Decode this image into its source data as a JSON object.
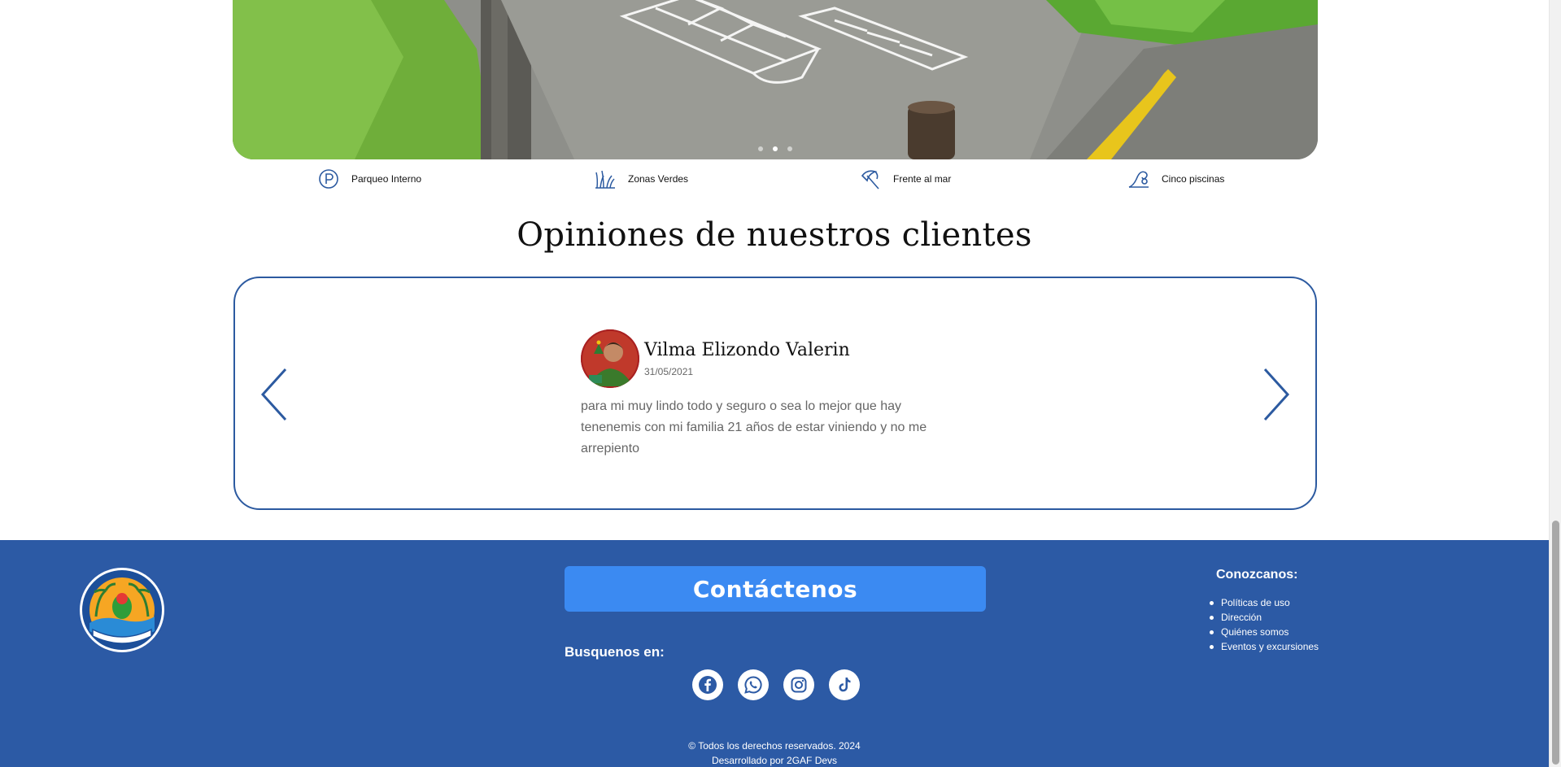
{
  "hero": {
    "slide_dots": 3,
    "active_dot": 1
  },
  "amenities": [
    {
      "icon": "parking-icon",
      "label": "Parqueo Interno"
    },
    {
      "icon": "grass-icon",
      "label": "Zonas Verdes"
    },
    {
      "icon": "beach-umbrella-icon",
      "label": "Frente al mar"
    },
    {
      "icon": "wave-icon",
      "label": "Cinco piscinas"
    }
  ],
  "reviews": {
    "title": "Opiniones de nuestros clientes",
    "current": {
      "name": "Vilma Elizondo Valerin",
      "date": "31/05/2021",
      "text": "para mi muy lindo todo y seguro o sea lo mejor que hay tenenemis con mi familia 21 años de estar viniendo y no me arrepiento"
    },
    "prev_icon": "chevron-left-icon",
    "next_icon": "chevron-right-icon"
  },
  "footer": {
    "contact_label": "Contáctenos",
    "search_label": "Busquenos en:",
    "socials": [
      "facebook-icon",
      "whatsapp-icon",
      "instagram-icon",
      "tiktok-icon"
    ],
    "links_title": "Conozcanos:",
    "links": [
      "Políticas de uso",
      "Dirección",
      "Quiénes somos",
      "Eventos y excursiones"
    ],
    "copyright": "© Todos los derechos reservados. 2024",
    "developer": "Desarrollado por 2GAF Devs"
  },
  "colors": {
    "footer_bg": "#2c5aa5",
    "contact_button": "#3b8af2",
    "accent_blue": "#2c5aa0"
  }
}
